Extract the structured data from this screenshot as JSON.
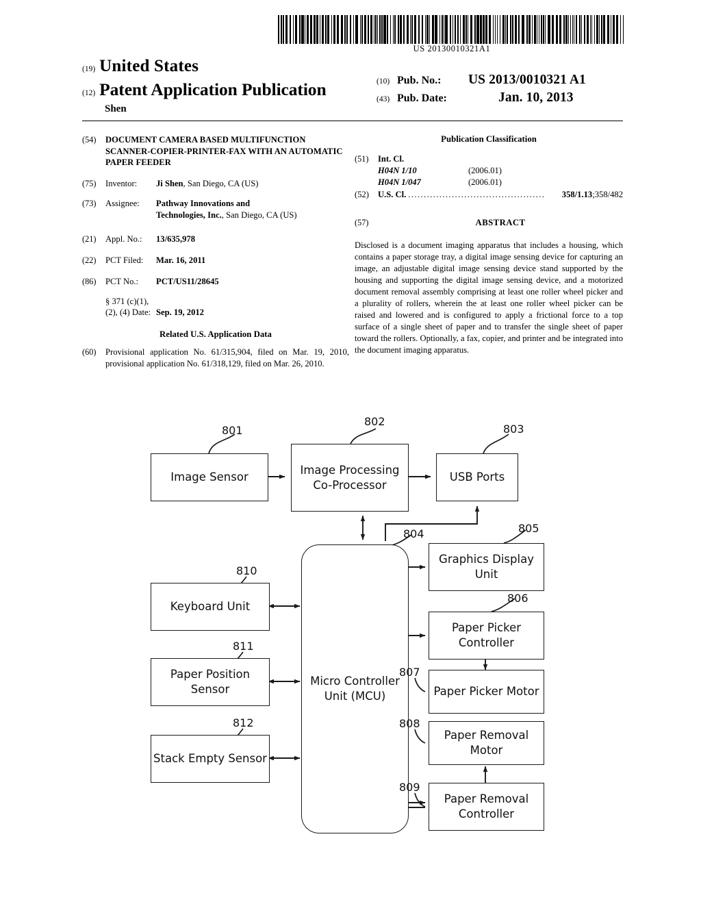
{
  "document": {
    "barcode_text": "US 20130010321A1",
    "kind": "patent-application-publication"
  },
  "header": {
    "inid_19": "(19)",
    "country": "United States",
    "inid_12": "(12)",
    "doc_type": "Patent Application Publication",
    "applicant_surname": "Shen",
    "inid_10": "(10)",
    "pub_no_label": "Pub. No.:",
    "pub_no_value": "US 2013/0010321 A1",
    "inid_43": "(43)",
    "pub_date_label": "Pub. Date:",
    "pub_date_value": "Jan. 10, 2013"
  },
  "left_column": {
    "title_field": {
      "tag": "(54)",
      "text": "DOCUMENT CAMERA BASED MULTIFUNCTION SCANNER-COPIER-PRINTER-FAX WITH AN AUTOMATIC PAPER FEEDER"
    },
    "inventor": {
      "tag": "(75)",
      "label": "Inventor:",
      "name": "Ji Shen",
      "rest": ", San Diego, CA (US)"
    },
    "assignee": {
      "tag": "(73)",
      "label": "Assignee:",
      "name_line1": "Pathway Innovations and",
      "name_line2": "Technologies, Inc.",
      "rest": ", San Diego, CA (US)"
    },
    "appl_no": {
      "tag": "(21)",
      "label": "Appl. No.:",
      "value": "13/635,978"
    },
    "pct_filed": {
      "tag": "(22)",
      "label": "PCT Filed:",
      "value": "Mar. 16, 2011"
    },
    "pct_no": {
      "tag": "(86)",
      "label": "PCT No.:",
      "value": "PCT/US11/28645"
    },
    "para371": {
      "line1": "§ 371 (c)(1),",
      "line2": "(2), (4) Date:",
      "value": "Sep. 19, 2012"
    },
    "related_heading": "Related U.S. Application Data",
    "related_data": {
      "tag": "(60)",
      "text": "Provisional application No. 61/315,904, filed on Mar. 19, 2010, provisional application No. 61/318,129, filed on Mar. 26, 2010."
    }
  },
  "right_column": {
    "classification_heading": "Publication Classification",
    "int_cl": {
      "tag": "(51)",
      "label": "Int. Cl.",
      "entries": [
        {
          "code": "H04N 1/10",
          "date": "(2006.01)"
        },
        {
          "code": "H04N 1/047",
          "date": "(2006.01)"
        }
      ]
    },
    "us_cl": {
      "tag": "(52)",
      "label": "U.S. Cl.",
      "dots": "............................................",
      "primary": "358/1.13",
      "separator": "; ",
      "secondary": "358/482"
    },
    "abstract": {
      "tag": "(57)",
      "heading": "ABSTRACT",
      "text": "Disclosed is a document imaging apparatus that includes a housing, which contains a paper storage tray, a digital image sensing device for capturing an image, an adjustable digital image sensing device stand supported by the housing and supporting the digital image sensing device, and a motorized document removal assembly comprising at least one roller wheel picker and a plurality of rollers, wherein the at least one roller wheel picker can be raised and lowered and is configured to apply a frictional force to a top surface of a single sheet of paper and to transfer the single sheet of paper toward the rollers. Optionally, a fax, copier, and printer and be integrated into the document imaging apparatus."
    }
  },
  "figure": {
    "blocks": [
      {
        "id": "image-sensor",
        "ref": "801",
        "label": "Image Sensor"
      },
      {
        "id": "image-processing",
        "ref": "802",
        "label": "Image Processing Co-Processor"
      },
      {
        "id": "usb-ports",
        "ref": "803",
        "label": "USB Ports"
      },
      {
        "id": "micro-controller-unit",
        "ref": "804",
        "label": "Micro Controller Unit (MCU)"
      },
      {
        "id": "graphics-display-unit",
        "ref": "805",
        "label": "Graphics Display Unit"
      },
      {
        "id": "paper-picker-controller",
        "ref": "806",
        "label": "Paper Picker Controller"
      },
      {
        "id": "paper-picker-motor",
        "ref": "807",
        "label": "Paper Picker Motor"
      },
      {
        "id": "paper-removal-motor",
        "ref": "808",
        "label": "Paper Removal Motor"
      },
      {
        "id": "paper-removal-controller",
        "ref": "809",
        "label": "Paper Removal Controller"
      },
      {
        "id": "keyboard-unit",
        "ref": "810",
        "label": "Keyboard Unit"
      },
      {
        "id": "paper-position-sensor",
        "ref": "811",
        "label": "Paper Position Sensor"
      },
      {
        "id": "stack-empty-sensor",
        "ref": "812",
        "label": "Stack Empty Sensor"
      }
    ]
  }
}
